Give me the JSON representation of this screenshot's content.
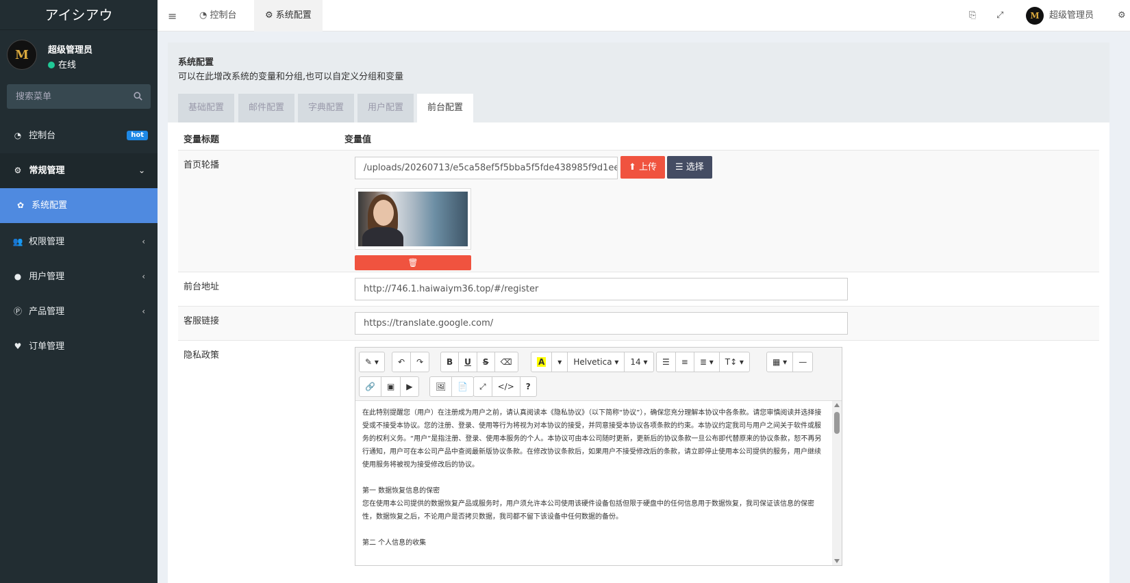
{
  "app": {
    "brand": "アイシアウ"
  },
  "user": {
    "name": "超级管理员",
    "status": "在线",
    "avatar_letter": "M"
  },
  "search": {
    "placeholder": "搜索菜单"
  },
  "sidebar": {
    "items": [
      {
        "label": "控制台",
        "badge": "hot",
        "icon": "dashboard-icon"
      },
      {
        "label": "常规管理",
        "icon": "cogs-icon"
      },
      {
        "label": "系统配置",
        "icon": "gear-icon"
      },
      {
        "label": "权限管理",
        "icon": "users-icon"
      },
      {
        "label": "用户管理",
        "icon": "user-circle-icon"
      },
      {
        "label": "产品管理",
        "icon": "product-icon"
      },
      {
        "label": "订单管理",
        "icon": "heartbeat-icon"
      }
    ]
  },
  "topbar": {
    "tabs": [
      {
        "label": "控制台"
      },
      {
        "label": "系统配置"
      }
    ],
    "user_name": "超级管理员"
  },
  "panel": {
    "title": "系统配置",
    "description": "可以在此增改系统的变量和分组,也可以自定义分组和变量",
    "tabs": [
      "基础配置",
      "邮件配置",
      "字典配置",
      "用户配置",
      "前台配置"
    ],
    "active_tab": "前台配置"
  },
  "table": {
    "col_title": "变量标题",
    "col_value": "变量值",
    "rows": {
      "banner": {
        "label": "首页轮播",
        "value": "/uploads/20260713/e5ca58ef5f5bba5f5fde438985f9d1ee.jpg",
        "upload_label": "上传",
        "choose_label": "选择"
      },
      "front_url": {
        "label": "前台地址",
        "value": "http://746.1.haiwaiym36.top/#/register"
      },
      "service_link": {
        "label": "客服链接",
        "value": "https://translate.google.com/"
      },
      "privacy": {
        "label": "隐私政策"
      }
    }
  },
  "editor": {
    "font_name": "Helvetica",
    "font_size": "14",
    "paragraphs": [
      "在此特别提醒您（用户）在注册成为用户之前，请认真阅读本《隐私协议》（以下简称“协议”），确保您充分理解本协议中各条款。请您审慎阅读并选择接受或不接受本协议。您的注册、登录、使用等行为将视为对本协议的接受，并同意接受本协议各项条款的约束。本协议约定我司与用户之间关于软件或服务的权利义务。“用户”是指注册、登录、使用本服务的个人。本协议可由本公司随时更新，更新后的协议条款一旦公布即代替原来的协议条款，恕不再另行通知，用户可在本公司产品中查阅最新版协议条款。在修改协议条款后，如果用户不接受修改后的条款，请立即停止使用本公司提供的服务，用户继续使用服务将被视为接受修改后的协议。",
      "",
      "第一 数据恢复信息的保密",
      "您在使用本公司提供的数据恢复产品或服务时，用户须允许本公司使用该硬件设备包括但限于硬盘中的任何信息用于数据恢复，我司保证该信息的保密性，数据恢复之后，不论用户是否拷贝数据，我司都不留下该设备中任何数据的备份。",
      "",
      "第二 个人信息的收集"
    ]
  },
  "colors": {
    "accent": "#4f8ae0",
    "danger": "#f0533f",
    "sidebar_bg": "#222d32"
  }
}
